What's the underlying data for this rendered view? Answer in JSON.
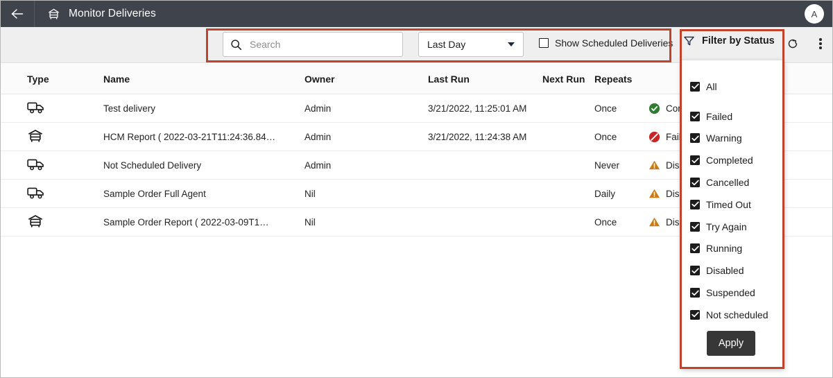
{
  "appbar": {
    "back_icon": "arrow-left-icon",
    "title_icon": "delivery-report-icon",
    "title": "Monitor Deliveries",
    "avatar_initial": "A"
  },
  "toolbar": {
    "search": {
      "icon": "search-icon",
      "value": "",
      "placeholder": "Search"
    },
    "date_range": {
      "selected": "Last Day",
      "caret_icon": "chevron-down-icon",
      "options": [
        "Last Day"
      ]
    },
    "show_scheduled": {
      "label": "Show Scheduled Deliveries",
      "checked": false
    },
    "refresh_icon": "refresh-icon",
    "more_icon": "kebab-menu-icon"
  },
  "filter": {
    "icon": "funnel-filter-icon",
    "title": "Filter by Status",
    "options": [
      {
        "label": "All",
        "checked": true
      },
      {
        "label": "Failed",
        "checked": true
      },
      {
        "label": "Warning",
        "checked": true
      },
      {
        "label": "Completed",
        "checked": true
      },
      {
        "label": "Cancelled",
        "checked": true
      },
      {
        "label": "Timed Out",
        "checked": true
      },
      {
        "label": "Try Again",
        "checked": true
      },
      {
        "label": "Running",
        "checked": true
      },
      {
        "label": "Disabled",
        "checked": true
      },
      {
        "label": "Suspended",
        "checked": true
      },
      {
        "label": "Not scheduled",
        "checked": true
      }
    ],
    "apply_label": "Apply"
  },
  "table": {
    "headers": {
      "type": "Type",
      "name": "Name",
      "owner": "Owner",
      "last_run": "Last Run",
      "next_run": "Next Run",
      "repeats": "Repeats"
    },
    "rows": [
      {
        "type_icon": "delivery-truck-icon",
        "name": "Test delivery",
        "owner": "Admin",
        "last_run": "3/21/2022, 11:25:01 AM",
        "next_run": "",
        "repeats": "Once",
        "status": "Compl",
        "status_icon": "check-circle-icon",
        "status_color": "#2f7d32"
      },
      {
        "type_icon": "report-icon",
        "name": "HCM Report ( 2022-03-21T11:24:36.84…",
        "owner": "Admin",
        "last_run": "3/21/2022, 11:24:38 AM",
        "next_run": "",
        "repeats": "Once",
        "status": "Failed",
        "status_icon": "error-circle-icon",
        "status_color": "#c62828"
      },
      {
        "type_icon": "delivery-truck-icon",
        "name": "Not Scheduled Delivery",
        "owner": "Admin",
        "last_run": "",
        "next_run": "",
        "repeats": "Never",
        "status": "Disabl",
        "status_icon": "warning-triangle-icon",
        "status_color": "#cc7a14"
      },
      {
        "type_icon": "delivery-truck-icon",
        "name": "Sample Order Full Agent",
        "owner": "Nil",
        "last_run": "",
        "next_run": "",
        "repeats": "Daily",
        "status": "Disabl",
        "status_icon": "warning-triangle-icon",
        "status_color": "#cc7a14"
      },
      {
        "type_icon": "report-icon",
        "name": "Sample Order Report ( 2022-03-09T1…",
        "owner": "Nil",
        "last_run": "",
        "next_run": "",
        "repeats": "Once",
        "status": "Disabl",
        "status_icon": "warning-triangle-icon",
        "status_color": "#cc7a14"
      }
    ]
  },
  "annotations": {
    "color": "#c0442b",
    "boxes": [
      {
        "name": "toolbar-highlight"
      },
      {
        "name": "filter-panel-highlight"
      }
    ]
  }
}
